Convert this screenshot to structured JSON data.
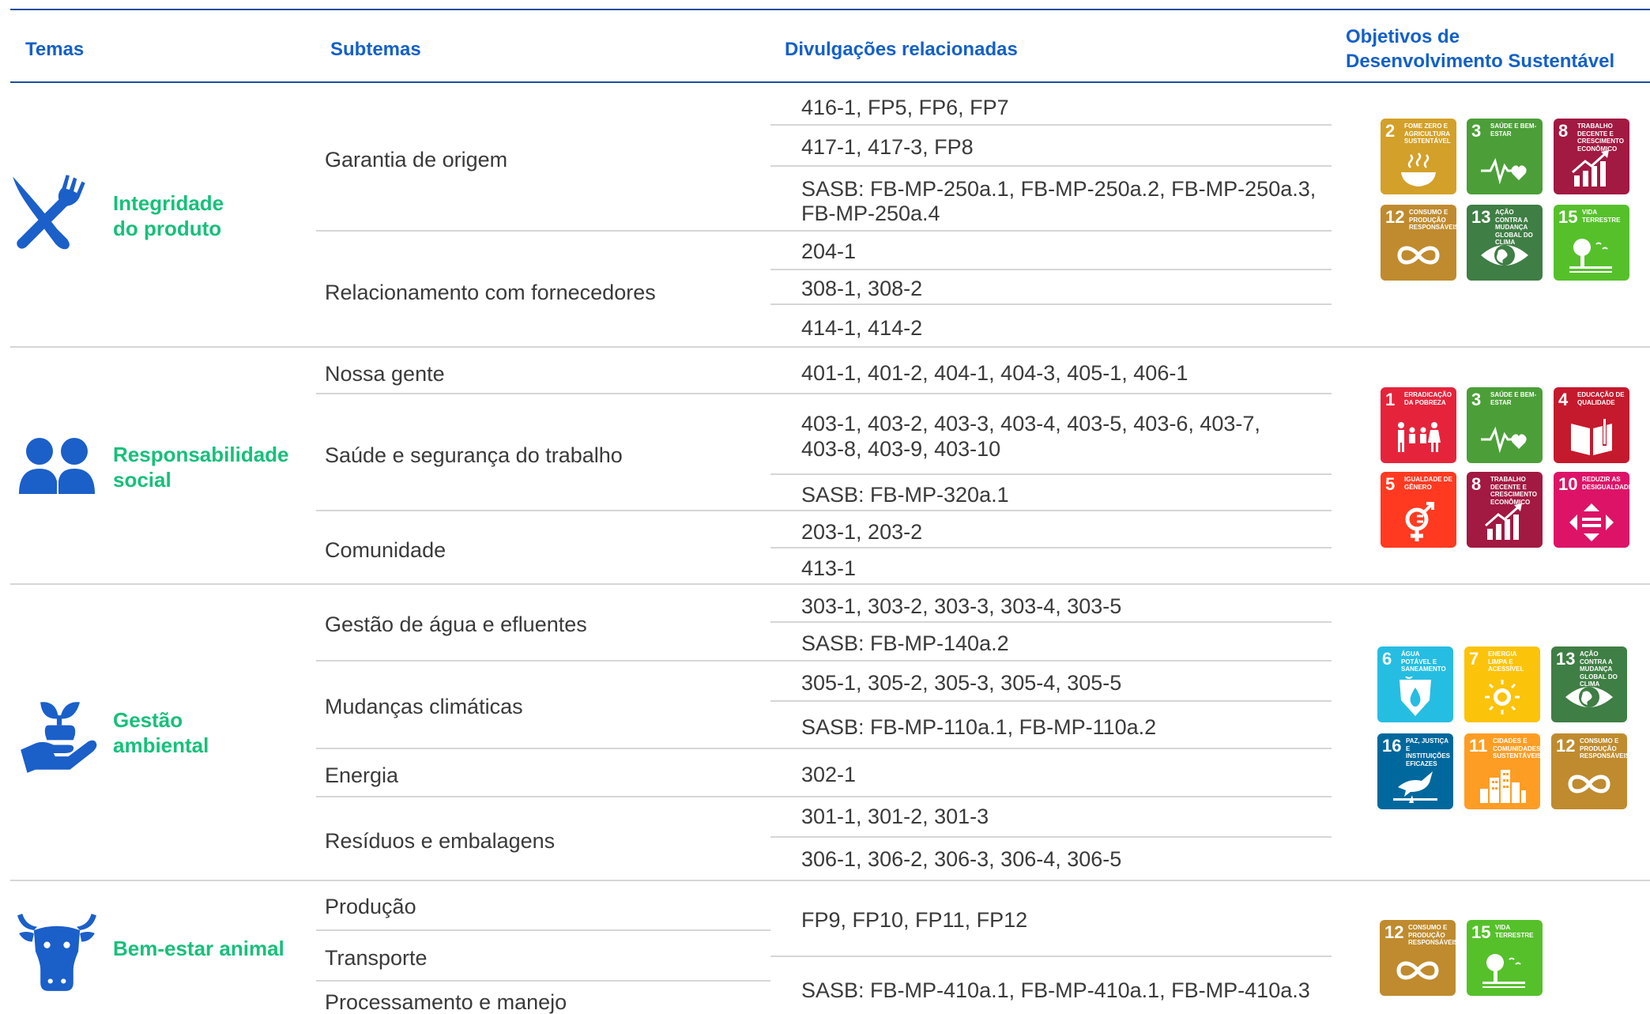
{
  "headers": {
    "temas": "Temas",
    "subtemas": "Subtemas",
    "divulgacoes": "Divulgações relacionadas",
    "ods_line1": "Objetivos de",
    "ods_line2": "Desenvolvimento Sustentável"
  },
  "colors": {
    "header_text": "#1460c8",
    "theme_text": "#17c07a",
    "icon_blue": "#1b5fc9",
    "rule": "#1f4f9c"
  },
  "themes": [
    {
      "icon": "fork-knife-icon",
      "title_l1": "Integridade",
      "title_l2": "do produto",
      "subthemes": [
        "Garantia de origem",
        "Relacionamento com fornecedores"
      ],
      "disclosures": [
        "416-1, FP5, FP6, FP7",
        "417-1, 417-3, FP8",
        "SASB: FB-MP-250a.1, FB-MP-250a.2, FB-MP-250a.3,",
        "FB-MP-250a.4",
        "204-1",
        "308-1, 308-2",
        "414-1, 414-2"
      ],
      "sdgs": [
        {
          "num": "2",
          "label": "Fome zero e agricultura sustentável",
          "color": "#d3a029",
          "icon": "bowl-icon"
        },
        {
          "num": "3",
          "label": "Saúde e bem-estar",
          "color": "#4c9f38",
          "icon": "heartbeat-icon"
        },
        {
          "num": "8",
          "label": "Trabalho decente e crescimento econômico",
          "color": "#a21942",
          "icon": "growth-chart-icon"
        },
        {
          "num": "12",
          "label": "Consumo e produção responsáveis",
          "color": "#bf8b2e",
          "icon": "infinity-icon"
        },
        {
          "num": "13",
          "label": "Ação contra a mudança global do clima",
          "color": "#3f7e44",
          "icon": "eye-globe-icon"
        },
        {
          "num": "15",
          "label": "Vida terrestre",
          "color": "#56c02b",
          "icon": "tree-icon"
        }
      ]
    },
    {
      "icon": "people-icon",
      "title_l1": "Responsabilidade",
      "title_l2": "social",
      "subthemes": [
        "Nossa gente",
        "Saúde e segurança do trabalho",
        "Comunidade"
      ],
      "disclosures": [
        "401-1, 401-2, 404-1, 404-3, 405-1, 406-1",
        "403-1, 403-2, 403-3, 403-4, 403-5, 403-6, 403-7,",
        "403-8, 403-9, 403-10",
        "SASB: FB-MP-320a.1",
        "203-1, 203-2",
        "413-1"
      ],
      "sdgs": [
        {
          "num": "1",
          "label": "Erradicação da pobreza",
          "color": "#e5243b",
          "icon": "family-icon"
        },
        {
          "num": "3",
          "label": "Saúde e bem-estar",
          "color": "#4c9f38",
          "icon": "heartbeat-icon"
        },
        {
          "num": "4",
          "label": "Educação de qualidade",
          "color": "#c5192d",
          "icon": "book-icon"
        },
        {
          "num": "5",
          "label": "Igualdade de gênero",
          "color": "#ff3a21",
          "icon": "gender-icon"
        },
        {
          "num": "8",
          "label": "Trabalho decente e crescimento econômico",
          "color": "#a21942",
          "icon": "growth-chart-icon"
        },
        {
          "num": "10",
          "label": "Reduzir as desigualdades",
          "color": "#dd1367",
          "icon": "arrows-icon"
        }
      ]
    },
    {
      "icon": "hand-plant-icon",
      "title_l1": "Gestão",
      "title_l2": "ambiental",
      "subthemes": [
        "Gestão de água e efluentes",
        "Mudanças climáticas",
        "Energia",
        "Resíduos e embalagens"
      ],
      "disclosures": [
        "303-1, 303-2, 303-3, 303-4, 303-5",
        "SASB: FB-MP-140a.2",
        "305-1, 305-2, 305-3, 305-4, 305-5",
        "SASB: FB-MP-110a.1, FB-MP-110a.2",
        "302-1",
        "301-1, 301-2, 301-3",
        "306-1, 306-2, 306-3, 306-4, 306-5"
      ],
      "sdgs": [
        {
          "num": "6",
          "label": "Água potável e saneamento",
          "color": "#26bde2",
          "icon": "water-drop-icon"
        },
        {
          "num": "7",
          "label": "Energia limpa e acessível",
          "color": "#fcc30b",
          "icon": "sun-icon"
        },
        {
          "num": "13",
          "label": "Ação contra a mudança global do clima",
          "color": "#3f7e44",
          "icon": "eye-globe-icon"
        },
        {
          "num": "16",
          "label": "Paz, justiça e instituições eficazes",
          "color": "#00689d",
          "icon": "dove-icon"
        },
        {
          "num": "11",
          "label": "Cidades e comunidades sustentáveis",
          "color": "#fd9d24",
          "icon": "city-icon"
        },
        {
          "num": "12",
          "label": "Consumo e produção responsáveis",
          "color": "#bf8b2e",
          "icon": "infinity-icon"
        }
      ]
    },
    {
      "icon": "cow-icon",
      "title_l1": "Bem-estar animal",
      "subthemes": [
        "Produção",
        "Transporte",
        "Processamento e manejo"
      ],
      "disclosures": [
        "FP9, FP10, FP11, FP12",
        "SASB: FB-MP-410a.1, FB-MP-410a.1, FB-MP-410a.3"
      ],
      "sdgs": [
        {
          "num": "12",
          "label": "Consumo e produção responsáveis",
          "color": "#bf8b2e",
          "icon": "infinity-icon"
        },
        {
          "num": "15",
          "label": "Vida terrestre",
          "color": "#56c02b",
          "icon": "tree-icon"
        }
      ]
    }
  ]
}
